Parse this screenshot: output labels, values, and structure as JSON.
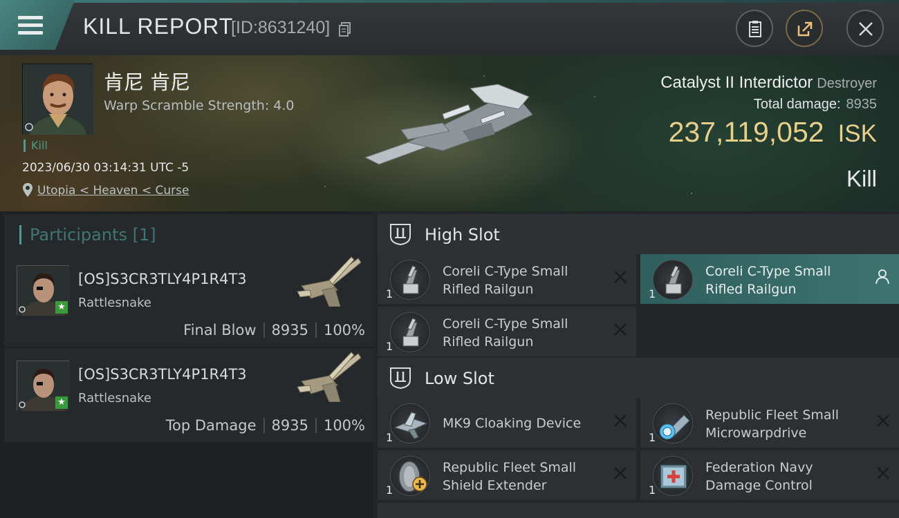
{
  "header": {
    "title": "KILL REPORT",
    "id_label": "[ID:8631240]"
  },
  "victim": {
    "name": "肯尼 肯尼",
    "warp_scramble": "Warp Scramble Strength: 4.0",
    "kill_tag": "Kill",
    "time": "2023/06/30 03:14:31 UTC -5",
    "location": "Utopia < Heaven < Curse"
  },
  "ship": {
    "name": "Catalyst II Interdictor",
    "class": "Destroyer",
    "total_damage_label": "Total damage:",
    "total_damage": "8935",
    "isk_value": "237,119,052",
    "isk_unit": "ISK",
    "result": "Kill"
  },
  "participants": {
    "title": "Participants [1]",
    "rows": [
      {
        "name": "[OS]S3CR3TLY4P1R4T3",
        "ship": "Rattlesnake",
        "role": "Final Blow",
        "damage": "8935",
        "percent": "100%"
      },
      {
        "name": "[OS]S3CR3TLY4P1R4T3",
        "ship": "Rattlesnake",
        "role": "Top Damage",
        "damage": "8935",
        "percent": "100%"
      }
    ]
  },
  "fitting": {
    "high_slot": {
      "title": "High Slot",
      "modules": [
        {
          "qty": "1",
          "name_line1": "Coreli C-Type Small",
          "name_line2": "Rifled Railgun"
        },
        {
          "qty": "1",
          "name_line1": "Coreli C-Type Small",
          "name_line2": "Rifled Railgun"
        },
        {
          "qty": "1",
          "name_line1": "Coreli C-Type Small",
          "name_line2": "Rifled Railgun"
        }
      ]
    },
    "low_slot": {
      "title": "Low Slot",
      "modules": [
        {
          "qty": "1",
          "name_line1": "MK9 Cloaking Device",
          "name_line2": ""
        },
        {
          "qty": "1",
          "name_line1": "Republic Fleet Small",
          "name_line2": "Microwarpdrive"
        },
        {
          "qty": "1",
          "name_line1": "Republic Fleet Small",
          "name_line2": "Shield Extender"
        },
        {
          "qty": "1",
          "name_line1": "Federation Navy",
          "name_line2": "Damage Control"
        }
      ]
    }
  },
  "colors": {
    "accent_teal": "#4f9b94",
    "isk_gold": "#e8cf8a",
    "panel_bg": "#26292b"
  }
}
